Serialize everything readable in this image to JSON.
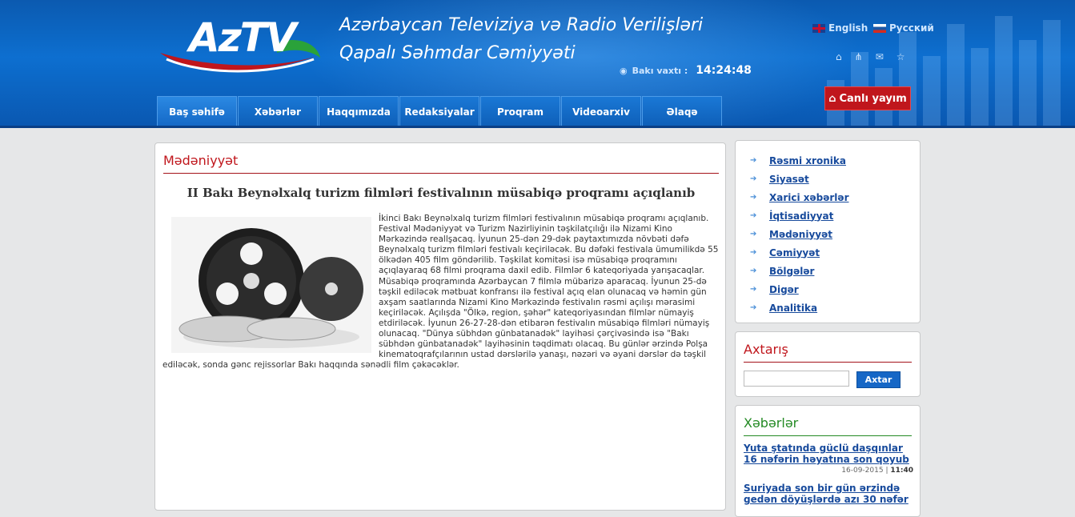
{
  "header": {
    "logo_text": "AzTV",
    "title_line1": "Azərbaycan Televiziya və Radio Verilişləri",
    "title_line2": "Qapalı Səhmdar Cəmiyyəti",
    "clock_label": "Bakı vaxtı :",
    "clock_time": "14:24:48",
    "lang_en": "English",
    "lang_ru": "Русский",
    "live_label": "Canlı yayım"
  },
  "nav": [
    "Baş səhifə",
    "Xəbərlər",
    "Haqqımızda",
    "Redaksiyalar",
    "Proqram",
    "Videoarxiv",
    "Əlaqə"
  ],
  "article": {
    "section": "Mədəniyyət",
    "title": "II Bakı Beynəlxalq turizm filmləri festivalının müsabiqə proqramı açıqlanıb",
    "body": "İkinci Bakı Beynəlxalq turizm filmləri festivalının müsabiqə proqramı açıqlanıb. Festival Mədəniyyət və Turizm Nazirliyinin təşkilatçılığı ilə Nizami Kino Mərkəzində reallşacaq. İyunun 25-dən 29-dək paytaxtımızda növbəti dəfə Beynəlxalq turizm filmləri festivalı keçiriləcək. Bu dəfəki festivala ümumilikdə 55 ölkədən 405 film göndərilib. Təşkilat komitəsi isə müsabiqə proqramını açıqlayaraq  68 filmi proqrama daxil edib. Filmlər 6 kateqoriyada yarışacaqlar. Müsabiqə proqramında  Azərbaycan 7 filmlə mübarizə aparacaq. İyunun 25-də təşkil ediləcək mətbuat konfransı ilə festival açıq elan olunacaq və həmin gün axşam saatlarında Nizami Kino Mərkəzində festivalın rəsmi açılışı mərasimi  keçiriləcək. Açılışda \"Ölkə, region, şəhər\" kateqoriyasından filmlər nümayiş etdiriləcək. İyunun 26-27-28-dən etibarən festivalın müsabiqə filmləri nümayiş olunacaq. \"Dünya sübhdən günbatanadək\" layihəsi çərçivəsində isə  \"Bakı sübhdən günbatanadək\" layihəsinin təqdimatı olacaq. Bu günlər ərzində Polşa kinematoqrafçılarının ustad dərslərilə yanaşı, nəzəri və əyani dərslər də  təşkil ediləcək, sonda gənc rejissorlar Bakı haqqında sənədli film çəkəcəklər."
  },
  "categories": [
    "Rəsmi xronika",
    "Siyasət",
    "Xarici xəbərlər",
    "İqtisadiyyat",
    "Mədəniyyət",
    "Cəmiyyət",
    "Bölgələr",
    "Digər",
    "Analitika"
  ],
  "search": {
    "title": "Axtarış",
    "button": "Axtar",
    "value": ""
  },
  "news": {
    "title": "Xəbərlər",
    "items": [
      {
        "title": "Yuta ştatında güclü daşqınlar 16 nəfərin həyatına son qoyub",
        "date": "16-09-2015",
        "time": "11:40"
      },
      {
        "title": "Suriyada son bir gün ərzində gedən döyüşlərdə azı 30 nəfər",
        "date": "",
        "time": ""
      }
    ]
  },
  "colors": {
    "header_blue": "#0d6fd0",
    "accent_red": "#c0161c",
    "link_blue": "#174a9c",
    "news_green": "#248a24"
  }
}
